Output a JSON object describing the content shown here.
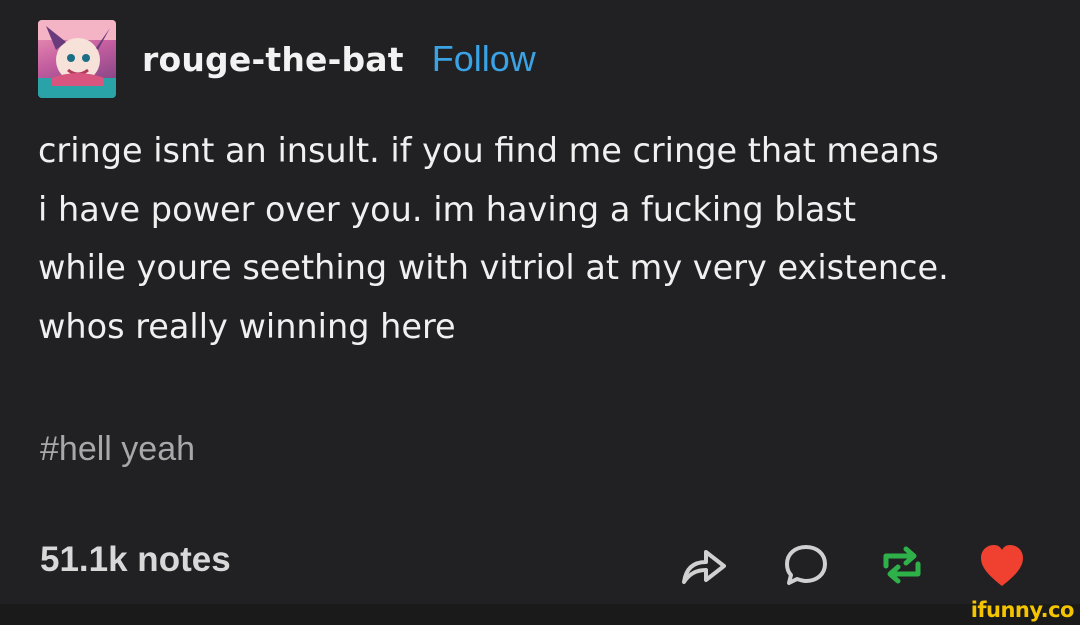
{
  "post": {
    "username": "rouge-the-bat",
    "follow_label": "Follow",
    "body_lines": [
      "cringe isnt an insult. if you find me cringe that means",
      "i have power over you. im having a fucking blast",
      "while youre seething with vitriol at my very existence.",
      "whos really winning here"
    ],
    "tag": "#hell yeah",
    "notes": "51.1k notes",
    "actions": [
      "share-icon",
      "reply-icon",
      "reblog-icon",
      "like-heart-icon"
    ]
  },
  "watermark": "ifunny.co",
  "colors": {
    "background": "#212123",
    "follow": "#3aa3e6",
    "reblog": "#2fb14a",
    "like": "#f0402f",
    "watermark": "#f5c400"
  }
}
